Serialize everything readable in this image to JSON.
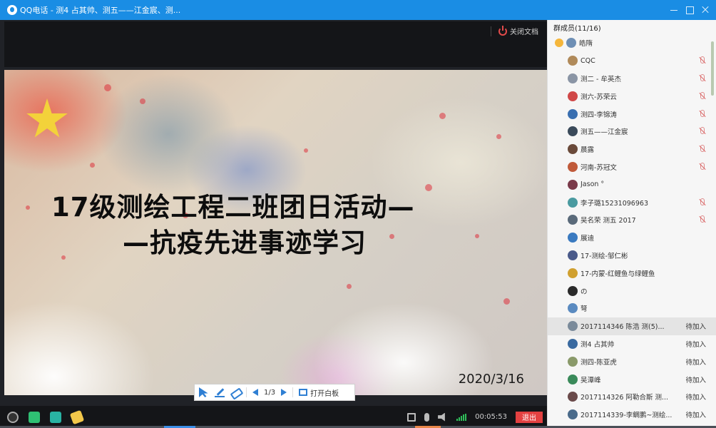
{
  "window": {
    "title": "QQ电话 - 测4   占其帅、测五——江金宸、测..."
  },
  "doc": {
    "close_label": "关闭文档",
    "slide_title_line1": "17级测绘工程二班团日活动—",
    "slide_title_line2": "—抗疫先进事迹学习",
    "slide_date": "2020/3/16",
    "page_indicator": "1/3",
    "open_whiteboard": "打开白板"
  },
  "call": {
    "duration": "00:05:53",
    "exit_label": "退出"
  },
  "panel": {
    "header": "群成员(11/16)",
    "members": [
      {
        "name": "皓隋",
        "color": "#6e8fb5",
        "owner": true,
        "muted": false,
        "status": ""
      },
      {
        "name": "CQC",
        "color": "#b08a5a",
        "owner": false,
        "muted": true,
        "status": ""
      },
      {
        "name": "测二 - 牟英杰",
        "color": "#8a95a5",
        "owner": false,
        "muted": true,
        "status": ""
      },
      {
        "name": "测六-苏荣云",
        "color": "#d04848",
        "owner": false,
        "muted": true,
        "status": ""
      },
      {
        "name": "测四-李锦涛",
        "color": "#3a6fb0",
        "owner": false,
        "muted": true,
        "status": ""
      },
      {
        "name": "测五——江金宸",
        "color": "#3a4a5a",
        "owner": false,
        "muted": true,
        "status": ""
      },
      {
        "name": "晨露",
        "color": "#6a4a3a",
        "owner": false,
        "muted": true,
        "status": ""
      },
      {
        "name": "河南-苏冠文",
        "color": "#c05a3a",
        "owner": false,
        "muted": true,
        "status": ""
      },
      {
        "name": "Jason °",
        "color": "#7a3a4a",
        "owner": false,
        "muted": false,
        "status": ""
      },
      {
        "name": "李子璐15231096963",
        "color": "#4a9aa0",
        "owner": false,
        "muted": true,
        "status": ""
      },
      {
        "name": "吴名荣  测五  2017",
        "color": "#5a6a7a",
        "owner": false,
        "muted": true,
        "status": ""
      },
      {
        "name": "展迪",
        "color": "#3a7ac0",
        "owner": false,
        "muted": false,
        "status": ""
      },
      {
        "name": "17-测绘-邹仁彬",
        "color": "#4a5a8a",
        "owner": false,
        "muted": false,
        "status": ""
      },
      {
        "name": "17-内蒙-红鲤鱼与绿鲤鱼",
        "color": "#d0a030",
        "owner": false,
        "muted": false,
        "status": ""
      },
      {
        "name": "の",
        "color": "#2a2a2a",
        "owner": false,
        "muted": false,
        "status": ""
      },
      {
        "name": "弩",
        "color": "#5a8ac0",
        "owner": false,
        "muted": false,
        "status": ""
      },
      {
        "name": "2017114346    陈浩  测(5)...",
        "color": "#7a8a9a",
        "owner": false,
        "muted": false,
        "status": "待加入",
        "active": true
      },
      {
        "name": "测4   占其帅",
        "color": "#3a6aa0",
        "owner": false,
        "muted": false,
        "status": "待加入"
      },
      {
        "name": "测四-陈亚虎",
        "color": "#8a9a6a",
        "owner": false,
        "muted": false,
        "status": "待加入"
      },
      {
        "name": "吴潭峰",
        "color": "#3a8a5a",
        "owner": false,
        "muted": false,
        "status": "待加入"
      },
      {
        "name": "2017114326 阿勒合斯  测...",
        "color": "#6a4a4a",
        "owner": false,
        "muted": false,
        "status": "待加入"
      },
      {
        "name": "2017114339-李鲷鹏~测绘...",
        "color": "#4a6a8a",
        "owner": false,
        "muted": false,
        "status": "待加入"
      }
    ]
  }
}
